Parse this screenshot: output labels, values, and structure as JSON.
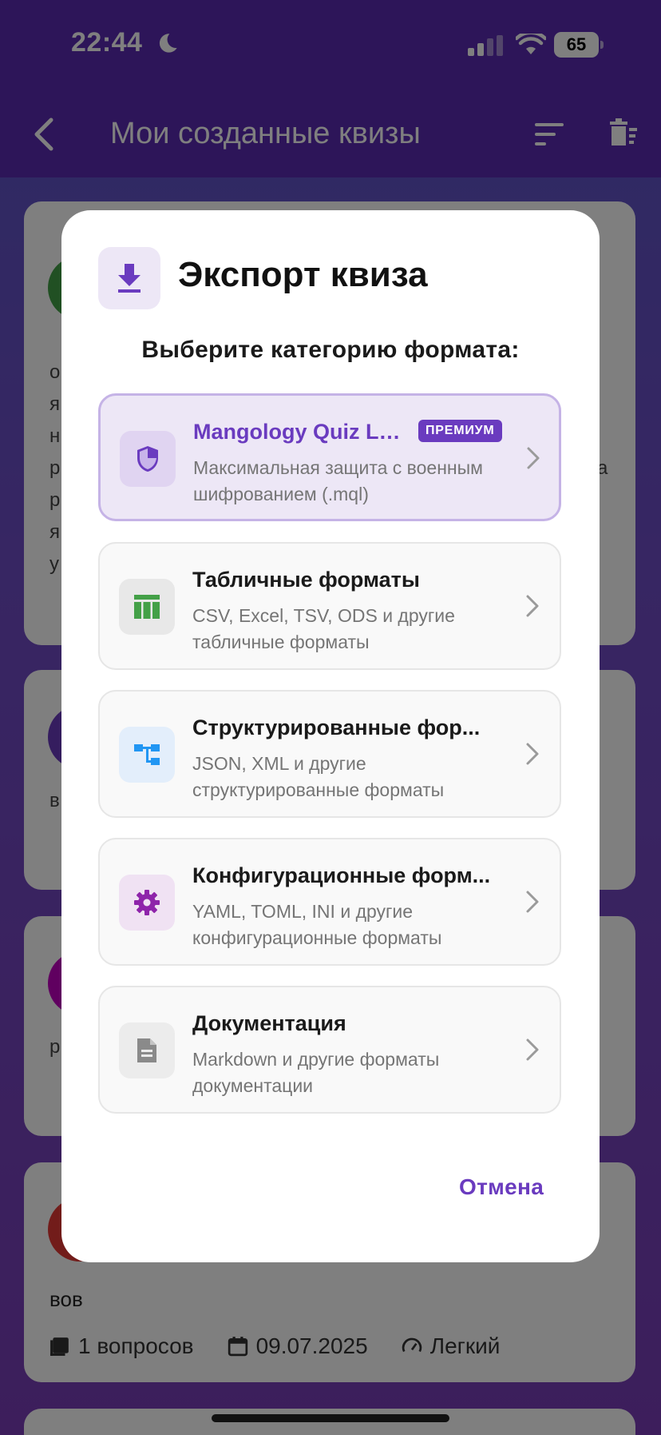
{
  "status_bar": {
    "time": "22:44",
    "battery": "65"
  },
  "app_bar": {
    "title": "Мои созданные квизы"
  },
  "background_cards": [
    {
      "text_lines": [
        "о",
        "я",
        "н",
        "р",
        "р",
        "я",
        "у"
      ],
      "right_fragment": "а"
    },
    {
      "text": "в"
    },
    {
      "text": "р"
    },
    {
      "text": "вов",
      "questions": "1 вопросов",
      "date": "09.07.2025",
      "difficulty": "Легкий"
    }
  ],
  "dialog": {
    "title": "Экспорт квиза",
    "subtitle": "Выберите категорию формата:",
    "options": [
      {
        "title": "Mangology Quiz Lo...",
        "badge": "ПРЕМИУМ",
        "description": "Максимальная защита с военным шифрованием (.mql)",
        "icon": "shield-icon",
        "icon_bg": "#e0d4f1",
        "icon_color": "#6a3bbf"
      },
      {
        "title": "Табличные форматы",
        "description": "CSV, Excel, TSV, ODS и другие табличные форматы",
        "icon": "table-icon",
        "icon_bg": "#e8e8e8",
        "icon_color": "#43a047"
      },
      {
        "title": "Структурированные фор...",
        "description": "JSON, XML и другие структурированные форматы",
        "icon": "tree-structure-icon",
        "icon_bg": "#e3eefb",
        "icon_color": "#2196f3"
      },
      {
        "title": "Конфигурационные форм...",
        "description": "YAML, TOML, INI и другие конфигурационные форматы",
        "icon": "gear-icon",
        "icon_bg": "#f0e2f3",
        "icon_color": "#8e24aa"
      },
      {
        "title": "Документация",
        "description": "Markdown и другие форматы документации",
        "icon": "document-icon",
        "icon_bg": "#ececec",
        "icon_color": "#8a8a8a"
      }
    ],
    "cancel_label": "Отмена"
  },
  "colors": {
    "accent": "#6a3bbf",
    "app_bar": "#5a2bb3"
  }
}
